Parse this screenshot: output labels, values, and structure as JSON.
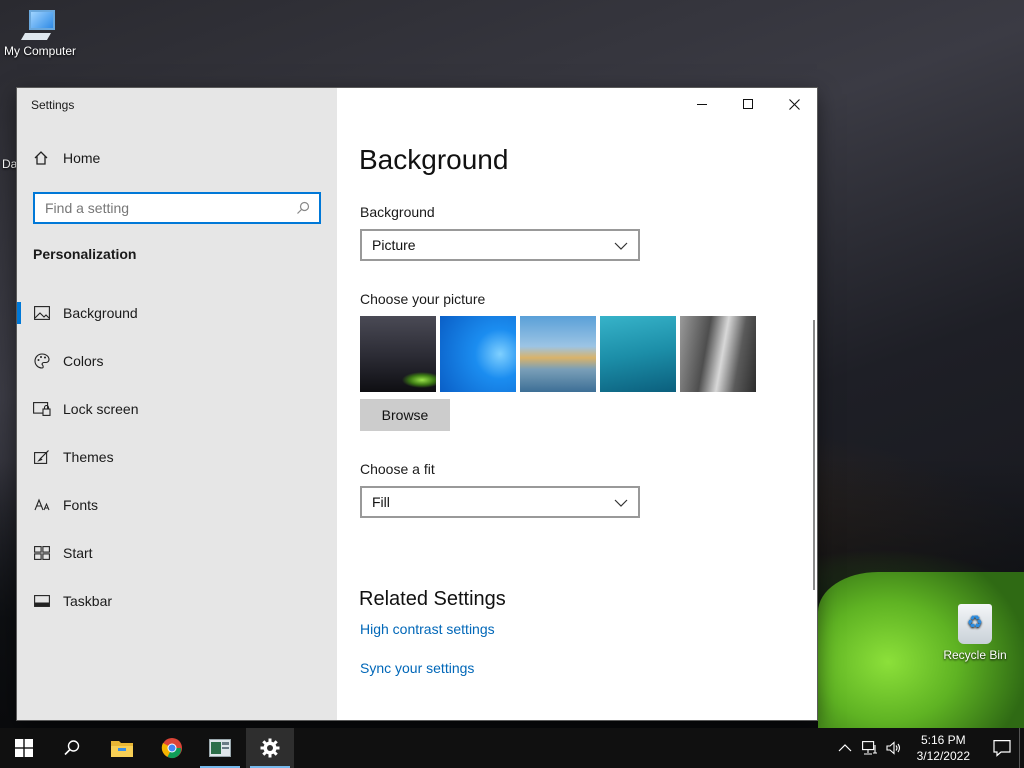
{
  "desktop": {
    "icons": [
      {
        "label": "My Computer"
      },
      {
        "label": "Recycle Bin"
      }
    ],
    "partial_label": "Da"
  },
  "window": {
    "title": "Settings",
    "nav": {
      "home_label": "Home",
      "search_placeholder": "Find a setting",
      "section_title": "Personalization",
      "items": [
        {
          "label": "Background",
          "icon": "picture-icon",
          "active": true
        },
        {
          "label": "Colors",
          "icon": "palette-icon",
          "active": false
        },
        {
          "label": "Lock screen",
          "icon": "lock-screen-icon",
          "active": false
        },
        {
          "label": "Themes",
          "icon": "brush-icon",
          "active": false
        },
        {
          "label": "Fonts",
          "icon": "font-icon",
          "active": false
        },
        {
          "label": "Start",
          "icon": "start-grid-icon",
          "active": false
        },
        {
          "label": "Taskbar",
          "icon": "taskbar-icon",
          "active": false
        }
      ]
    },
    "content": {
      "page_title": "Background",
      "background_label": "Background",
      "background_value": "Picture",
      "choose_picture_label": "Choose your picture",
      "browse_label": "Browse",
      "choose_fit_label": "Choose a fit",
      "fit_value": "Fill",
      "related_title": "Related Settings",
      "links": [
        "High contrast settings",
        "Sync your settings"
      ]
    }
  },
  "taskbar": {
    "time": "5:16 PM",
    "date": "3/12/2022",
    "apps": [
      "start-icon",
      "search-icon",
      "file-explorer-icon",
      "chrome-icon",
      "app-icon",
      "settings-icon"
    ]
  },
  "colors": {
    "accent": "#0078d7",
    "link": "#0067b8",
    "nav_bg": "#e6e6e6",
    "taskbar_bg": "#101010"
  }
}
